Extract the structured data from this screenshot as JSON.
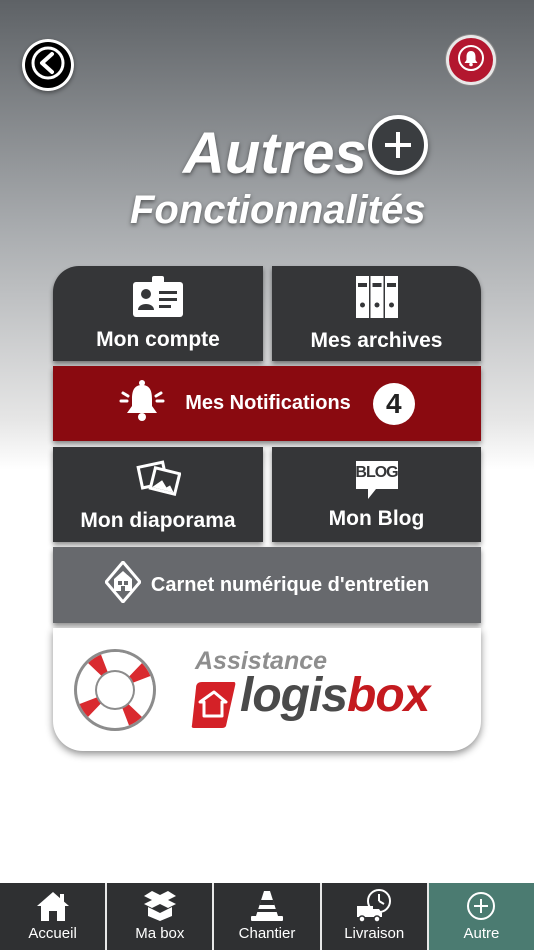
{
  "header": {
    "back_icon": "chevron-left-icon",
    "bell_icon": "bell-icon"
  },
  "title": {
    "main": "Autres",
    "sub": "Fonctionnalités",
    "icon": "plus-circle-icon"
  },
  "tiles": {
    "compte": {
      "label": "Mon compte",
      "icon": "id-card-icon"
    },
    "archives": {
      "label": "Mes archives",
      "icon": "binders-icon"
    },
    "notifications": {
      "label": "Mes Notifications",
      "icon": "bell-icon",
      "count": "4"
    },
    "diaporama": {
      "label": "Mon diaporama",
      "icon": "photos-icon"
    },
    "blog": {
      "label": "Mon Blog",
      "icon": "blog-icon",
      "icon_text": "BLOG"
    },
    "carnet": {
      "label": "Carnet numérique d'entretien",
      "icon": "house-book-icon"
    }
  },
  "assistance": {
    "label": "Assistance",
    "brand_logis": "logis",
    "brand_box": "box",
    "icon": "lifebuoy-icon"
  },
  "nav": {
    "items": [
      {
        "label": "Accueil",
        "icon": "home-icon"
      },
      {
        "label": "Ma box",
        "icon": "box-icon"
      },
      {
        "label": "Chantier",
        "icon": "traffic-cone-icon"
      },
      {
        "label": "Livraison",
        "icon": "delivery-truck-icon"
      },
      {
        "label": "Autre",
        "icon": "plus-circle-icon"
      }
    ],
    "active_index": 4
  },
  "colors": {
    "notification_red": "#8a0a10",
    "bell_red": "#b3172f",
    "active_nav": "#4b7b71",
    "brand_red": "#c41a1f"
  }
}
